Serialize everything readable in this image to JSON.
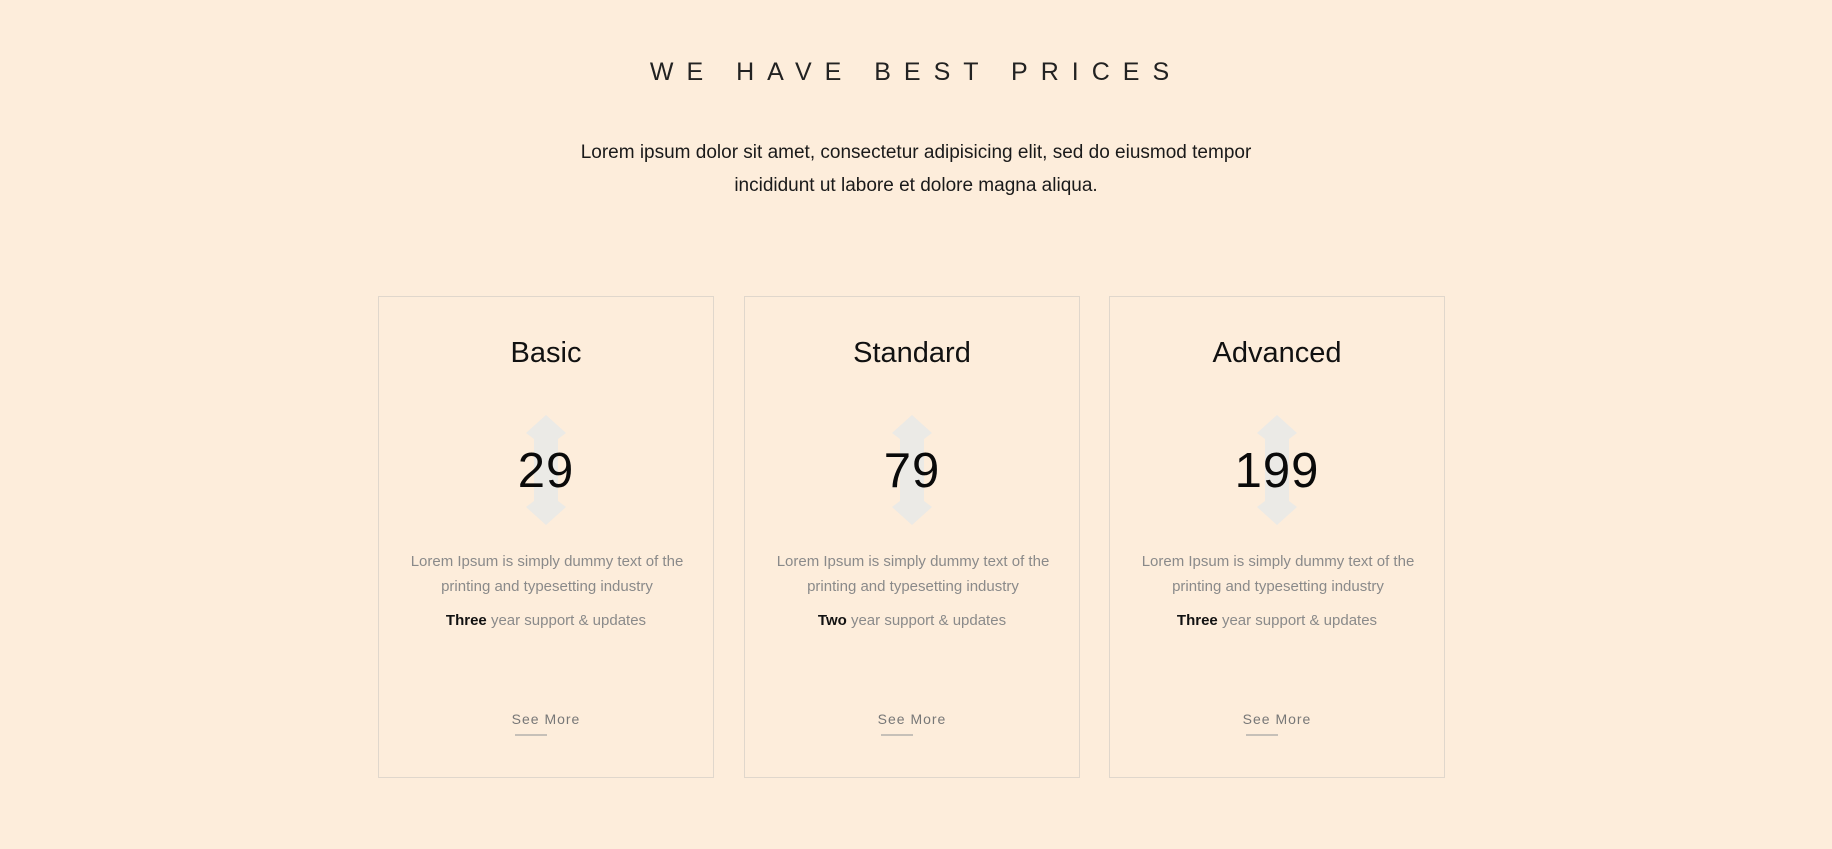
{
  "section": {
    "title": "WE HAVE BEST PRICES",
    "intro": "Lorem ipsum dolor sit amet, consectetur adipisicing elit, sed do eiusmod tempor incididunt ut labore et dolore magna aliqua."
  },
  "currency_icon": "dollar-sign-icon",
  "plans": [
    {
      "name": "Basic",
      "price": "29",
      "description": "Lorem Ipsum is simply dummy text of the printing and typesetting industry",
      "support_strong": "Three",
      "support_text": "year support & updates",
      "button": "See More"
    },
    {
      "name": "Standard",
      "price": "79",
      "description": "Lorem Ipsum is simply dummy text of the printing and typesetting industry",
      "support_strong": "Two",
      "support_text": "year support & updates",
      "button": "See More"
    },
    {
      "name": "Advanced",
      "price": "199",
      "description": "Lorem Ipsum is simply dummy text of the printing and typesetting industry",
      "support_strong": "Three",
      "support_text": "year support & updates",
      "button": "See More"
    }
  ],
  "colors": {
    "background": "#fdeddb",
    "card_border": "#e0d7cc",
    "currency_icon": "#ebeae6"
  }
}
